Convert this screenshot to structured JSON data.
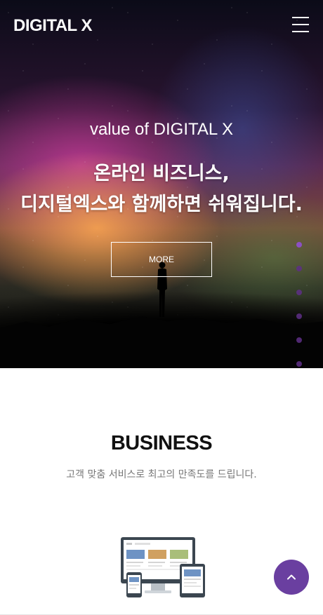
{
  "header": {
    "logo": "DIGITAL X",
    "menu_icon": "hamburger-menu-icon"
  },
  "hero": {
    "subtitle": "value of DIGITAL X",
    "title_line1": "온라인 비즈니스,",
    "title_line2": "디지털엑스와 함께하면 쉬워집니다.",
    "more_label": "MORE",
    "slides": [
      {
        "active": true
      },
      {
        "active": false
      },
      {
        "active": false
      },
      {
        "active": false
      },
      {
        "active": false
      },
      {
        "active": false
      }
    ]
  },
  "business": {
    "title": "BUSINESS",
    "description": "고객 맞춤 서비스로 최고의 만족도를 드립니다.",
    "illustration_icon": "responsive-devices-icon"
  },
  "scroll_top": {
    "icon": "chevron-up-icon"
  },
  "colors": {
    "accent": "#6a3fa0",
    "dot_active": "#8c4fc4",
    "dot_inactive": "#5e2f86",
    "title_text": "#111111",
    "desc_text": "#777777"
  }
}
